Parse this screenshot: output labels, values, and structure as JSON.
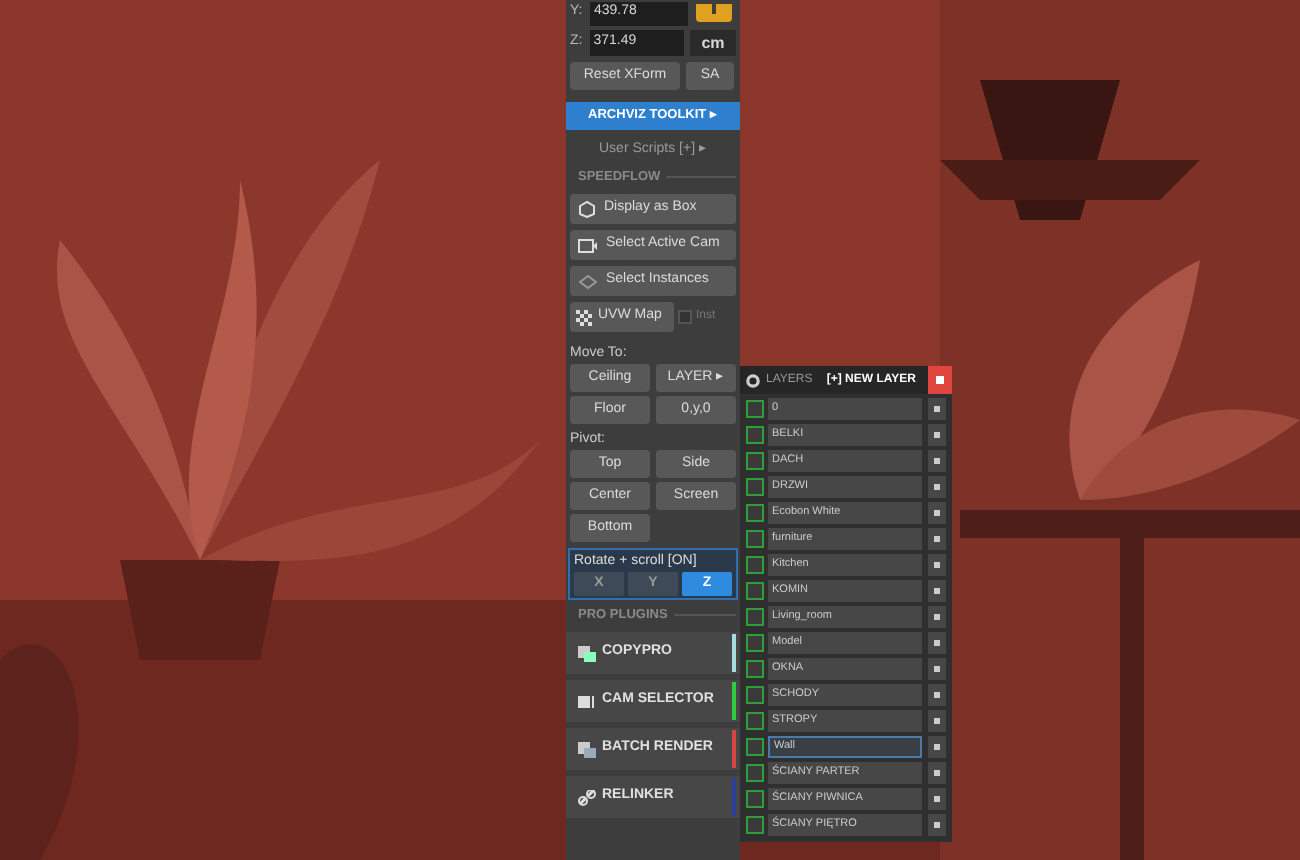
{
  "transform": {
    "y_label": "Y:",
    "y_value": "439.78",
    "z_label": "Z:",
    "z_value": "371.49",
    "unit": "cm",
    "reset": "Reset XForm",
    "sa": "SA"
  },
  "toolkit_button": "ARCHVIZ TOOLKIT ▸",
  "user_scripts": "User Scripts [+] ▸",
  "speedflow": {
    "title": "SPEEDFLOW",
    "items": [
      {
        "label": "Display as Box"
      },
      {
        "label": "Select Active Cam"
      },
      {
        "label": "Select Instances"
      }
    ],
    "uvw": "UVW Map",
    "inst": {
      "label": "Inst",
      "checked": false
    }
  },
  "move_to": {
    "title": "Move To:",
    "buttons": [
      "Ceiling",
      "LAYER ▸",
      "Floor",
      "0,y,0"
    ]
  },
  "pivot": {
    "title": "Pivot:",
    "buttons": [
      "Top",
      "Side",
      "Center",
      "Screen",
      "Bottom"
    ]
  },
  "rotate": {
    "title": "Rotate + scroll  [ON]",
    "axes": [
      {
        "label": "X",
        "selected": false
      },
      {
        "label": "Y",
        "selected": false
      },
      {
        "label": "Z",
        "selected": true
      }
    ]
  },
  "pro_plugins": {
    "title": "PRO PLUGINS",
    "items": [
      {
        "label": "COPYPRO",
        "color": "#a8dde0"
      },
      {
        "label": "CAM SELECTOR",
        "color": "#2ecc40"
      },
      {
        "label": "BATCH RENDER",
        "color": "#d64545"
      },
      {
        "label": "RELINKER",
        "color": "#2a3f9a"
      }
    ]
  },
  "layers": {
    "title": "LAYERS",
    "new_layer": "[+] NEW LAYER",
    "rows": [
      {
        "name": "0",
        "selected": false,
        "checked": false
      },
      {
        "name": "BELKI",
        "selected": false,
        "checked": false
      },
      {
        "name": "DACH",
        "selected": false,
        "checked": false
      },
      {
        "name": "DRZWI",
        "selected": false,
        "checked": false
      },
      {
        "name": "Ecobon White",
        "selected": false,
        "checked": false
      },
      {
        "name": "furniture",
        "selected": false,
        "checked": false
      },
      {
        "name": "Kitchen",
        "selected": false,
        "checked": false
      },
      {
        "name": "KOMIN",
        "selected": false,
        "checked": false
      },
      {
        "name": "Living_room",
        "selected": false,
        "checked": false
      },
      {
        "name": "Model",
        "selected": false,
        "checked": false
      },
      {
        "name": "OKNA",
        "selected": false,
        "checked": false
      },
      {
        "name": "SCHODY",
        "selected": false,
        "checked": false
      },
      {
        "name": "STROPY",
        "selected": false,
        "checked": false
      },
      {
        "name": "Wall",
        "selected": true,
        "checked": false
      },
      {
        "name": "ŚCIANY PARTER",
        "selected": false,
        "checked": false
      },
      {
        "name": "ŚCIANY PIWNICA",
        "selected": false,
        "checked": false
      },
      {
        "name": "ŚCIANY PIĘTRO",
        "selected": false,
        "checked": false
      }
    ]
  }
}
